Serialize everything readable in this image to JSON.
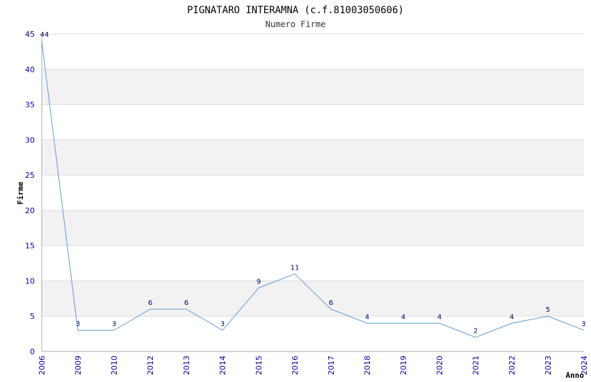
{
  "chart_data": {
    "type": "line",
    "title": "PIGNATARO INTERAMNA (c.f.81003050606)",
    "subtitle": "Numero Firme",
    "xlabel": "Anno",
    "ylabel": "Firme",
    "categories": [
      "2006",
      "2009",
      "2010",
      "2012",
      "2013",
      "2014",
      "2015",
      "2016",
      "2017",
      "2018",
      "2019",
      "2020",
      "2021",
      "2022",
      "2023",
      "2024"
    ],
    "values": [
      44,
      3,
      3,
      6,
      6,
      3,
      9,
      11,
      6,
      4,
      4,
      4,
      2,
      4,
      5,
      3
    ],
    "ylim": [
      0,
      45
    ],
    "yticks": [
      "0",
      "5",
      "10",
      "15",
      "20",
      "25",
      "30",
      "35",
      "40",
      "45"
    ],
    "grid": true,
    "colors": {
      "line": "#5b9bd5",
      "band": "#f2f2f2",
      "tick_text": "#0000aa",
      "label_text": "#000066"
    }
  }
}
